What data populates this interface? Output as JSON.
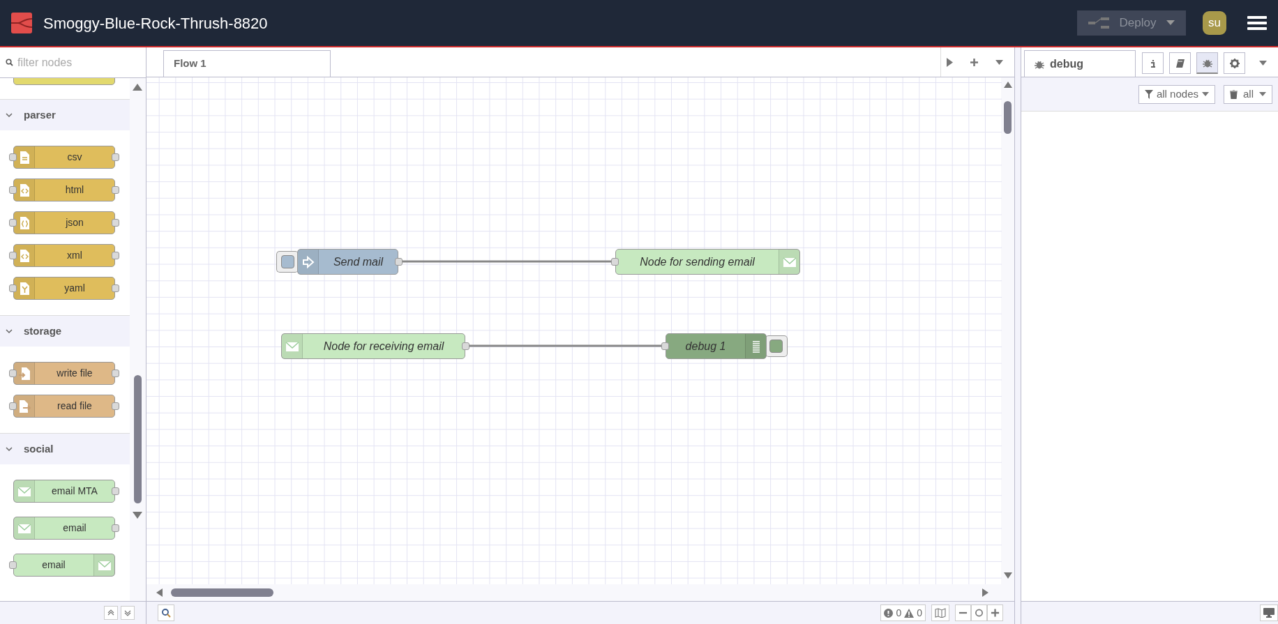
{
  "header": {
    "title": "Smoggy-Blue-Rock-Thrush-8820",
    "deploy": {
      "label": "Deploy",
      "disabled": true
    },
    "user": {
      "initials": "su"
    }
  },
  "palette": {
    "filter": {
      "placeholder": "filter nodes"
    },
    "categories": [
      {
        "name": "parser",
        "expanded": true,
        "color": "#dfbd5c",
        "nodes": [
          {
            "label": "csv",
            "inputs": true,
            "outputs": true
          },
          {
            "label": "html",
            "inputs": true,
            "outputs": true
          },
          {
            "label": "json",
            "inputs": true,
            "outputs": true
          },
          {
            "label": "xml",
            "inputs": true,
            "outputs": true
          },
          {
            "label": "yaml",
            "inputs": true,
            "outputs": true
          }
        ]
      },
      {
        "name": "storage",
        "expanded": true,
        "color": "#deb887",
        "nodes": [
          {
            "label": "write file",
            "inputs": true,
            "outputs": true
          },
          {
            "label": "read file",
            "inputs": true,
            "outputs": true
          }
        ]
      },
      {
        "name": "social",
        "expanded": true,
        "color": "#c7e9c0",
        "nodes": [
          {
            "label": "email MTA",
            "inputs": false,
            "outputs": true
          },
          {
            "label": "email",
            "inputs": false,
            "outputs": true
          },
          {
            "label": "email",
            "inputs": true,
            "outputs": false
          }
        ]
      }
    ]
  },
  "workspace": {
    "tabs": [
      {
        "label": "Flow 1",
        "selected": true
      }
    ],
    "wires": [
      {
        "source": {
          "label": "Send mail",
          "color": "#a6bbcf",
          "button": true,
          "inputs": false,
          "outputs": true
        },
        "target": {
          "label": "Node for sending email",
          "color": "#c7e9c0",
          "inputs": true,
          "outputs": false
        }
      },
      {
        "source": {
          "label": "Node for receiving email",
          "color": "#c7e9c0",
          "inputs": false,
          "outputs": true
        },
        "target": {
          "label": "debug 1",
          "color": "#87a980",
          "button": true,
          "inputs": true,
          "outputs": false
        }
      }
    ]
  },
  "status": {
    "errors": "0",
    "warnings": "0"
  },
  "sidebar": {
    "tab": {
      "label": "debug",
      "selected": true
    },
    "tools": [
      {
        "selected": false
      },
      {
        "selected": false
      },
      {
        "selected": true
      },
      {
        "selected": false
      }
    ],
    "filter": {
      "label": "all nodes"
    },
    "clear": {
      "label": "all"
    }
  }
}
